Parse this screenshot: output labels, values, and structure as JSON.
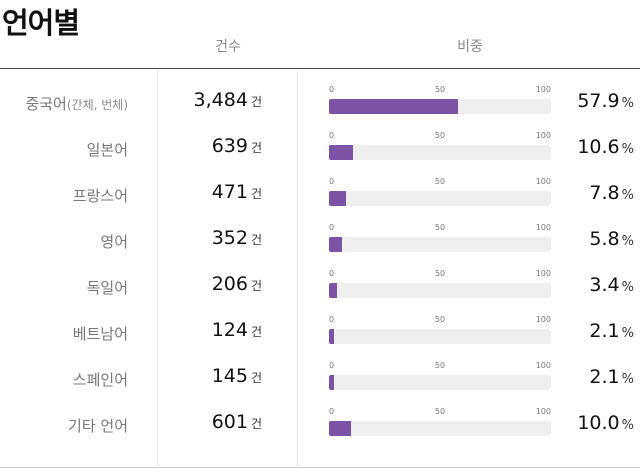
{
  "title": "언어별",
  "columns": {
    "count": "건수",
    "ratio": "비중"
  },
  "unit": "건",
  "percent_sign": "%",
  "colors": {
    "bar": "#7b52a6",
    "track": "#efefef"
  },
  "chart_data": {
    "type": "bar",
    "orientation": "horizontal",
    "xlim": [
      0,
      100
    ],
    "ticks": [
      "0",
      "50",
      "100"
    ],
    "rows": [
      {
        "label": "중국어",
        "note": "(간체, 번체)",
        "count": "3,484",
        "pct_label": "57.9",
        "value": 57.9
      },
      {
        "label": "일본어",
        "note": "",
        "count": "639",
        "pct_label": "10.6",
        "value": 10.6
      },
      {
        "label": "프랑스어",
        "note": "",
        "count": "471",
        "pct_label": "7.8",
        "value": 7.8
      },
      {
        "label": "영어",
        "note": "",
        "count": "352",
        "pct_label": "5.8",
        "value": 5.8
      },
      {
        "label": "독일어",
        "note": "",
        "count": "206",
        "pct_label": "3.4",
        "value": 3.4
      },
      {
        "label": "베트남어",
        "note": "",
        "count": "124",
        "pct_label": "2.1",
        "value": 2.1
      },
      {
        "label": "스페인어",
        "note": "",
        "count": "145",
        "pct_label": "2.1",
        "value": 2.1
      },
      {
        "label": "기타 언어",
        "note": "",
        "count": "601",
        "pct_label": "10.0",
        "value": 10.0
      }
    ]
  }
}
